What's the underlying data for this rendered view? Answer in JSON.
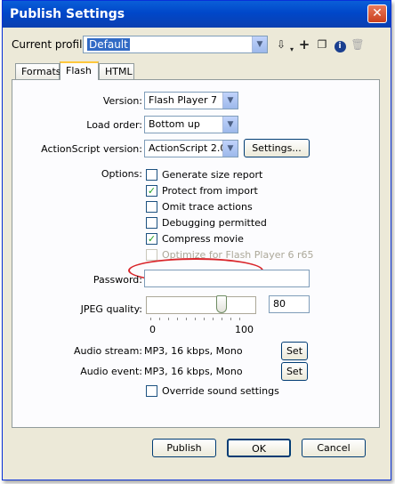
{
  "window": {
    "title": "Publish Settings"
  },
  "profile": {
    "label": "Current profile:",
    "value": "Default"
  },
  "tabs": [
    "Formats",
    "Flash",
    "HTML"
  ],
  "flash": {
    "version_label": "Version:",
    "version_value": "Flash Player 7",
    "load_order_label": "Load order:",
    "load_order_value": "Bottom up",
    "actionscript_label": "ActionScript version:",
    "actionscript_value": "ActionScript 2.0",
    "settings_button": "Settings...",
    "options_label": "Options:",
    "options": [
      {
        "label": "Generate size report",
        "checked": false,
        "disabled": false
      },
      {
        "label": "Protect from import",
        "checked": true,
        "disabled": false
      },
      {
        "label": "Omit trace actions",
        "checked": false,
        "disabled": false
      },
      {
        "label": "Debugging permitted",
        "checked": false,
        "disabled": false
      },
      {
        "label": "Compress movie",
        "checked": true,
        "disabled": false
      },
      {
        "label": "Optimize for Flash Player 6 r65",
        "checked": false,
        "disabled": true
      }
    ],
    "password_label": "Password:",
    "password_value": "",
    "jpeg_label": "JPEG quality:",
    "jpeg_value": "80",
    "jpeg_min": "0",
    "jpeg_max": "100",
    "jpeg_level": 0.8,
    "audio_stream_label": "Audio stream:",
    "audio_stream_value": "MP3, 16 kbps, Mono",
    "audio_event_label": "Audio event:",
    "audio_event_value": "MP3, 16 kbps, Mono",
    "set_button": "Set",
    "override_label": "Override sound settings",
    "override_checked": false
  },
  "footer": {
    "publish": "Publish",
    "ok": "OK",
    "cancel": "Cancel"
  },
  "icons": {
    "close": "close-icon",
    "import_export": "import-export-icon",
    "add": "add-profile-icon",
    "duplicate": "duplicate-profile-icon",
    "info": "info-icon",
    "delete": "delete-profile-icon"
  },
  "colors": {
    "titlebar": "#0054e3",
    "highlight_ellipse": "#d9252a",
    "checkmark": "#21a121"
  }
}
